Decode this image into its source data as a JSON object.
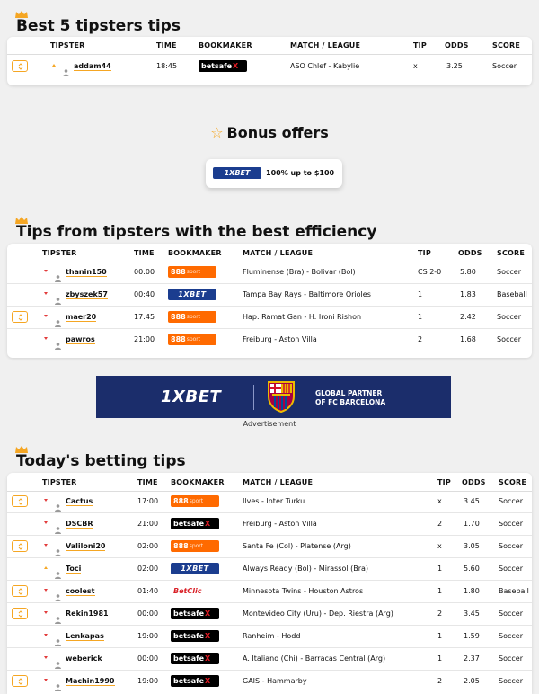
{
  "sections": {
    "best5": {
      "title": "Best 5 tipsters tips"
    },
    "bonus": {
      "title": "Bonus offers",
      "offer": {
        "logo": "1XBET",
        "text": "100% up to $100"
      }
    },
    "efficiency": {
      "title": "Tips from tipsters with the best efficiency"
    },
    "today": {
      "title": "Today's betting tips"
    }
  },
  "columns": {
    "tipster": "TIPSTER",
    "time": "TIME",
    "bookmaker": "BOOKMAKER",
    "match": "MATCH / LEAGUE",
    "tip": "TIP",
    "odds": "ODDS",
    "score": "SCORE"
  },
  "best5_rows": [
    {
      "tipster": "addam44",
      "time": "18:45",
      "bookmaker": "betsafe",
      "match": "ASO Chlef - Kabylie",
      "tip": "x",
      "odds": "3.25",
      "score": "Soccer",
      "trend": "up",
      "expandable": true
    }
  ],
  "efficiency_rows": [
    {
      "tipster": "thanin150",
      "time": "00:00",
      "bookmaker": "888",
      "match": "Fluminense (Bra) - Bolivar (Bol)",
      "tip": "CS 2-0",
      "odds": "5.80",
      "score": "Soccer",
      "trend": "down",
      "expandable": false
    },
    {
      "tipster": "zbyszek57",
      "time": "00:40",
      "bookmaker": "1xbet",
      "match": "Tampa Bay Rays - Baltimore Orioles",
      "tip": "1",
      "odds": "1.83",
      "score": "Baseball",
      "trend": "down",
      "expandable": false
    },
    {
      "tipster": "maer20",
      "time": "17:45",
      "bookmaker": "888",
      "match": "Hap. Ramat Gan - H. Ironi Rishon",
      "tip": "1",
      "odds": "2.42",
      "score": "Soccer",
      "trend": "down",
      "expandable": true
    },
    {
      "tipster": "pawros",
      "time": "21:00",
      "bookmaker": "888",
      "match": "Freiburg - Aston Villa",
      "tip": "2",
      "odds": "1.68",
      "score": "Soccer",
      "trend": "down",
      "expandable": false
    }
  ],
  "today_rows": [
    {
      "tipster": "Cactus",
      "time": "17:00",
      "bookmaker": "888",
      "match": "Ilves - Inter Turku",
      "tip": "x",
      "odds": "3.45",
      "score": "Soccer",
      "trend": "down",
      "expandable": true
    },
    {
      "tipster": "DSCBR",
      "time": "21:00",
      "bookmaker": "betsafe",
      "match": "Freiburg - Aston Villa",
      "tip": "2",
      "odds": "1.70",
      "score": "Soccer",
      "trend": "down",
      "expandable": false
    },
    {
      "tipster": "Valiloni20",
      "time": "02:00",
      "bookmaker": "888",
      "match": "Santa Fe (Col) - Platense (Arg)",
      "tip": "x",
      "odds": "3.05",
      "score": "Soccer",
      "trend": "down",
      "expandable": true
    },
    {
      "tipster": "Toci",
      "time": "02:00",
      "bookmaker": "1xbet",
      "match": "Always Ready (Bol) - Mirassol (Bra)",
      "tip": "1",
      "odds": "5.60",
      "score": "Soccer",
      "trend": "up",
      "expandable": false
    },
    {
      "tipster": "coolest",
      "time": "01:40",
      "bookmaker": "betclic",
      "match": "Minnesota Twins - Houston Astros",
      "tip": "1",
      "odds": "1.80",
      "score": "Baseball",
      "trend": "down",
      "expandable": true
    },
    {
      "tipster": "Rekin1981",
      "time": "00:00",
      "bookmaker": "betsafe",
      "match": "Montevideo City (Uru) - Dep. Riestra (Arg)",
      "tip": "2",
      "odds": "3.45",
      "score": "Soccer",
      "trend": "down",
      "expandable": true
    },
    {
      "tipster": "Lenkapas",
      "time": "19:00",
      "bookmaker": "betsafe",
      "match": "Ranheim - Hodd",
      "tip": "1",
      "odds": "1.59",
      "score": "Soccer",
      "trend": "down",
      "expandable": false
    },
    {
      "tipster": "weberick",
      "time": "00:00",
      "bookmaker": "betsafe",
      "match": "A. Italiano (Chi) - Barracas Central (Arg)",
      "tip": "1",
      "odds": "2.37",
      "score": "Soccer",
      "trend": "down",
      "expandable": false
    },
    {
      "tipster": "Machin1990",
      "time": "19:00",
      "bookmaker": "betsafe",
      "match": "GAIS - Hammarby",
      "tip": "2",
      "odds": "2.05",
      "score": "Soccer",
      "trend": "down",
      "expandable": true
    }
  ],
  "bookmaker_logos": {
    "betsafe": {
      "main": "betsafe",
      "accent": "X"
    },
    "888": {
      "main": "888",
      "accent": "sport"
    },
    "1xbet": {
      "main": "1XBET",
      "accent": ""
    },
    "betclic": {
      "main": "BetClic",
      "accent": ""
    }
  },
  "ad": {
    "brand": "1XBET",
    "line1": "GLOBAL PARTNER",
    "line2": "OF FC BARCELONA",
    "crest": "FCB",
    "label": "Advertisement"
  },
  "colors": {
    "accent": "#f5a623",
    "down": "#e23b3b",
    "xbet_blue": "#1b3d8f",
    "888_orange": "#ff6a00"
  }
}
